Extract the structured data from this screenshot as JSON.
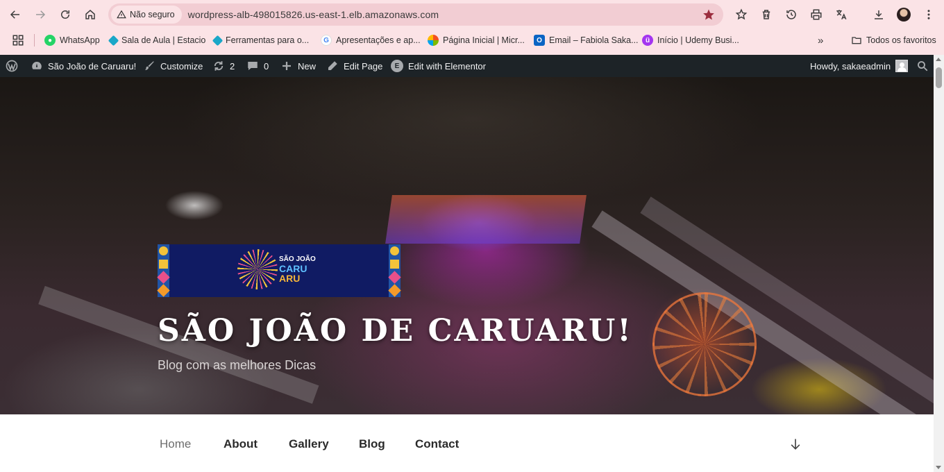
{
  "browser": {
    "security_label": "Não seguro",
    "url": "wordpress-alb-498015826.us-east-1.elb.amazonaws.com",
    "bookmarks": [
      {
        "label": "WhatsApp",
        "icon": "whatsapp-icon",
        "color": "#25d366"
      },
      {
        "label": "Sala de Aula | Estacio",
        "icon": "estacio-icon",
        "color": "#1aa7c8"
      },
      {
        "label": "Ferramentas para o...",
        "icon": "estacio-icon",
        "color": "#1aa7c8"
      },
      {
        "label": "Apresentações e ap...",
        "icon": "google-icon",
        "color": "#4285f4"
      },
      {
        "label": "Página Inicial | Micr...",
        "icon": "microsoft-icon",
        "color": "#c85ae0"
      },
      {
        "label": "Email – Fabiola Saka...",
        "icon": "outlook-icon",
        "color": "#0a64c4"
      },
      {
        "label": "Início | Udemy Busi...",
        "icon": "udemy-icon",
        "color": "#a435f0"
      }
    ],
    "all_bookmarks": "Todos os favoritos"
  },
  "adminbar": {
    "site_name": "São João de Caruaru!",
    "customize": "Customize",
    "updates_count": "2",
    "comments_count": "0",
    "new": "New",
    "edit_page": "Edit Page",
    "elementor": "Edit with Elementor",
    "howdy": "Howdy, sakaeadmin"
  },
  "hero": {
    "logo_line1": "SÃO JOÃO",
    "logo_line2": "CARU",
    "logo_line3": "ARU",
    "title": "SÃO JOÃO DE CARUARU!",
    "tagline": "Blog com as melhores Dicas"
  },
  "nav": {
    "items": [
      "Home",
      "About",
      "Gallery",
      "Blog",
      "Contact"
    ],
    "active": "Home"
  },
  "colors": {
    "chrome_bg": "#fbe3e6",
    "omnibox_bg": "#f2cdd3",
    "adminbar_bg": "#1d2327",
    "logo_bg": "#101b63",
    "bookmark_star": "#9b2d3e"
  }
}
